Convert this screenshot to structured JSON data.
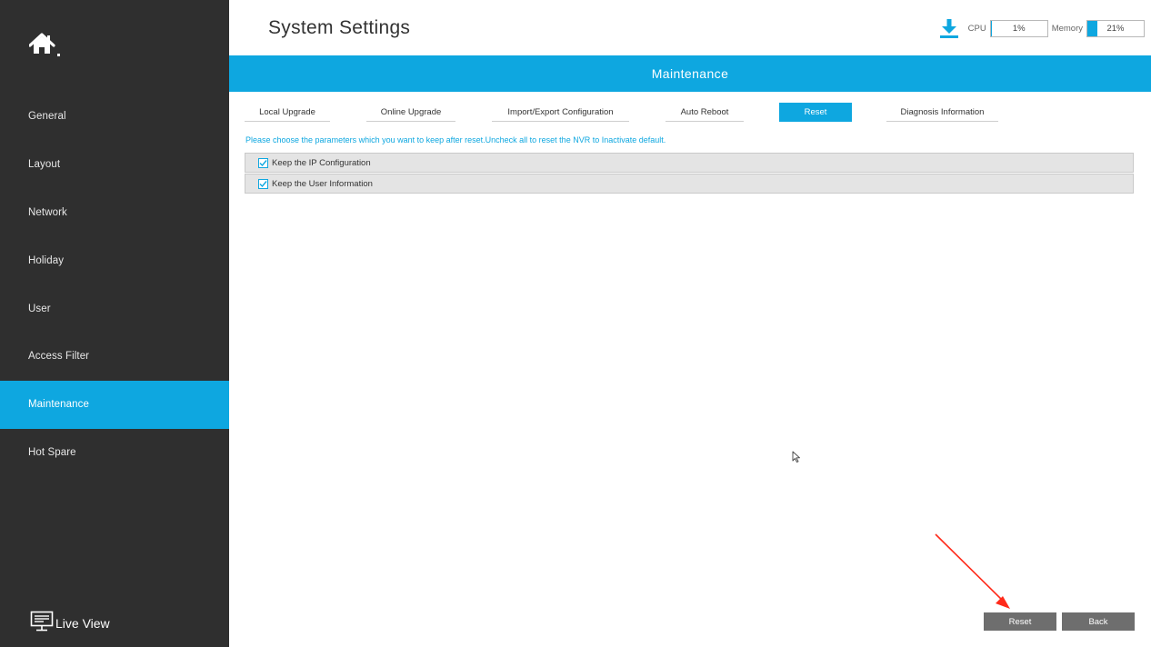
{
  "sidebar": {
    "items": [
      {
        "label": "General"
      },
      {
        "label": "Layout"
      },
      {
        "label": "Network"
      },
      {
        "label": "Holiday"
      },
      {
        "label": "User"
      },
      {
        "label": "Access Filter"
      },
      {
        "label": "Maintenance",
        "active": true
      },
      {
        "label": "Hot Spare"
      }
    ],
    "live_view_label": "Live View"
  },
  "header": {
    "title": "System Settings",
    "cpu_label": "CPU",
    "cpu_value": "1%",
    "cpu_fraction": 0.01,
    "memory_label": "Memory",
    "memory_value": "21%",
    "memory_fraction": 0.21
  },
  "section": {
    "title": "Maintenance",
    "tabs": [
      {
        "label": "Local Upgrade"
      },
      {
        "label": "Online Upgrade"
      },
      {
        "label": "Import/Export Configuration"
      },
      {
        "label": "Auto Reboot"
      },
      {
        "label": "Reset",
        "active": true
      },
      {
        "label": "Diagnosis Information"
      }
    ],
    "hint": "Please choose the parameters which you want to keep after reset.Uncheck all to reset the NVR to Inactivate default.",
    "options": [
      {
        "label": "Keep the IP Configuration",
        "checked": true
      },
      {
        "label": "Keep the User Information",
        "checked": true
      }
    ]
  },
  "buttons": {
    "reset_label": "Reset",
    "back_label": "Back"
  },
  "colors": {
    "accent": "#0ea7e0",
    "sidebar_bg": "#2f2f2f",
    "button_bg": "#6e6e6e",
    "annotation_arrow": "#ff2a1a"
  },
  "icons": [
    "home-icon",
    "download-icon",
    "monitor-icon",
    "checkbox-checked-icon",
    "mouse-cursor-icon"
  ]
}
